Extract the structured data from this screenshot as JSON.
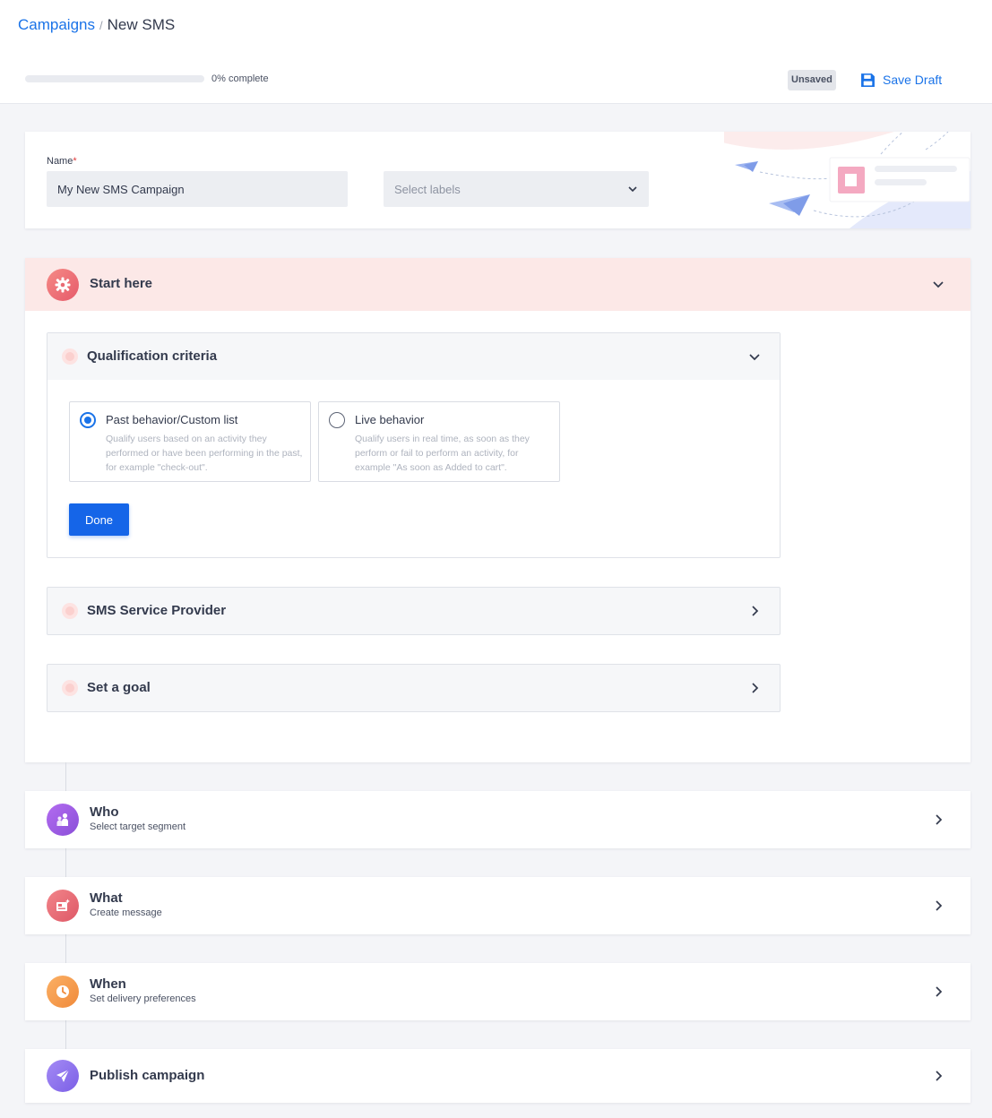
{
  "breadcrumb": {
    "parent": "Campaigns",
    "separator": "/",
    "current": "New SMS"
  },
  "progress": {
    "percent": 0,
    "label": "0% complete"
  },
  "status": {
    "label": "Unsaved"
  },
  "toolbar": {
    "save_draft": "Save Draft"
  },
  "name_card": {
    "name_label": "Name",
    "required_mark": "*",
    "name_value": "My New SMS Campaign",
    "labels_placeholder": "Select labels"
  },
  "start": {
    "title": "Start here",
    "qualification": {
      "title": "Qualification criteria",
      "options": [
        {
          "label": "Past behavior/Custom list",
          "description": "Qualify users based on an activity they performed or have been performing in the past, for example \"check-out\".",
          "selected": true
        },
        {
          "label": "Live behavior",
          "description": "Qualify users in real time, as soon as they perform or fail to perform an activity, for example \"As soon as Added to cart\".",
          "selected": false
        }
      ],
      "done_label": "Done"
    },
    "sms_provider": {
      "title": "SMS Service Provider"
    },
    "goal": {
      "title": "Set a goal"
    }
  },
  "steps": {
    "who": {
      "title": "Who",
      "subtitle": "Select target segment"
    },
    "what": {
      "title": "What",
      "subtitle": "Create message"
    },
    "when": {
      "title": "When",
      "subtitle": "Set delivery preferences"
    },
    "publish": {
      "title": "Publish campaign"
    }
  },
  "colors": {
    "accent": "#1a73e8",
    "start_header_bg": "#fce8e7",
    "who_icon": "#9b5de5",
    "what_icon": "#ec6b73",
    "when_icon": "#f79a4a",
    "publish_icon": "#8b6cf0"
  },
  "icons": {
    "save": "floppy-disk-icon",
    "start": "gear-icon",
    "who": "users-icon",
    "what": "message-icon",
    "when": "clock-icon",
    "publish": "paper-plane-icon",
    "expand": "chevron-down-icon",
    "navigate": "chevron-right-icon"
  }
}
